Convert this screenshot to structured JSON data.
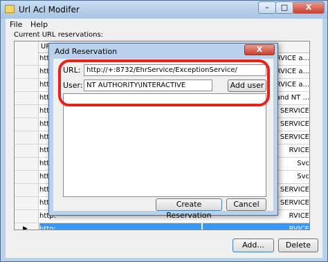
{
  "window": {
    "title": "Url Acl Modifer",
    "buttons": {
      "minimize": "–",
      "maximize": "□",
      "close": "X"
    }
  },
  "menu": [
    "File",
    "Help"
  ],
  "reservations_label": "Current URL reservations:",
  "grid": {
    "headers": [
      "URL",
      ""
    ],
    "rows": [
      {
        "url": "http:",
        "user": "SERVICE a...",
        "pointer": ""
      },
      {
        "url": "https:",
        "user": "SERVICE a...",
        "pointer": ""
      },
      {
        "url": "https:",
        "user": "ERVICE a...",
        "pointer": ""
      },
      {
        "url": "https:",
        "user": "and NT ...",
        "pointer": ""
      },
      {
        "url": "https:",
        "user": "T SERVICE",
        "pointer": ""
      },
      {
        "url": "http:",
        "user": "T SERVICE",
        "pointer": ""
      },
      {
        "url": "http:",
        "user": "T SERVICE",
        "pointer": ""
      },
      {
        "url": "http:",
        "user": "RVICE",
        "pointer": ""
      },
      {
        "url": "http:",
        "user": "Svc",
        "pointer": ""
      },
      {
        "url": "http:",
        "user": "Svc",
        "pointer": ""
      },
      {
        "url": "http:",
        "user": "K SERVICE",
        "pointer": ""
      },
      {
        "url": "http:",
        "user": "K SERVICE",
        "pointer": ""
      },
      {
        "url": "http:",
        "user": "RVICE",
        "pointer": ""
      },
      {
        "url": "http:",
        "user": "RVICE",
        "pointer": "▶"
      },
      {
        "url": "http://+:8732/EhrService/ExceptionService/",
        "user": "NT AUTHORITY\\INTERACTIVE",
        "pointer": ""
      }
    ],
    "selected_index": 13
  },
  "buttons": {
    "add": "Add...",
    "delete": "Delete"
  },
  "dialog": {
    "title": "Add Reservation",
    "close": "X",
    "url_label": "URL:",
    "url_value": "http://+:8732/EhrService/ExceptionService/",
    "user_label": "User:",
    "user_value": "NT AUTHORITY\\INTERACTIVE",
    "add_user": "Add user",
    "create": "Create Reservation",
    "cancel": "Cancel"
  },
  "colors": {
    "highlight": "#e8211b",
    "selection": "#3399ff"
  }
}
